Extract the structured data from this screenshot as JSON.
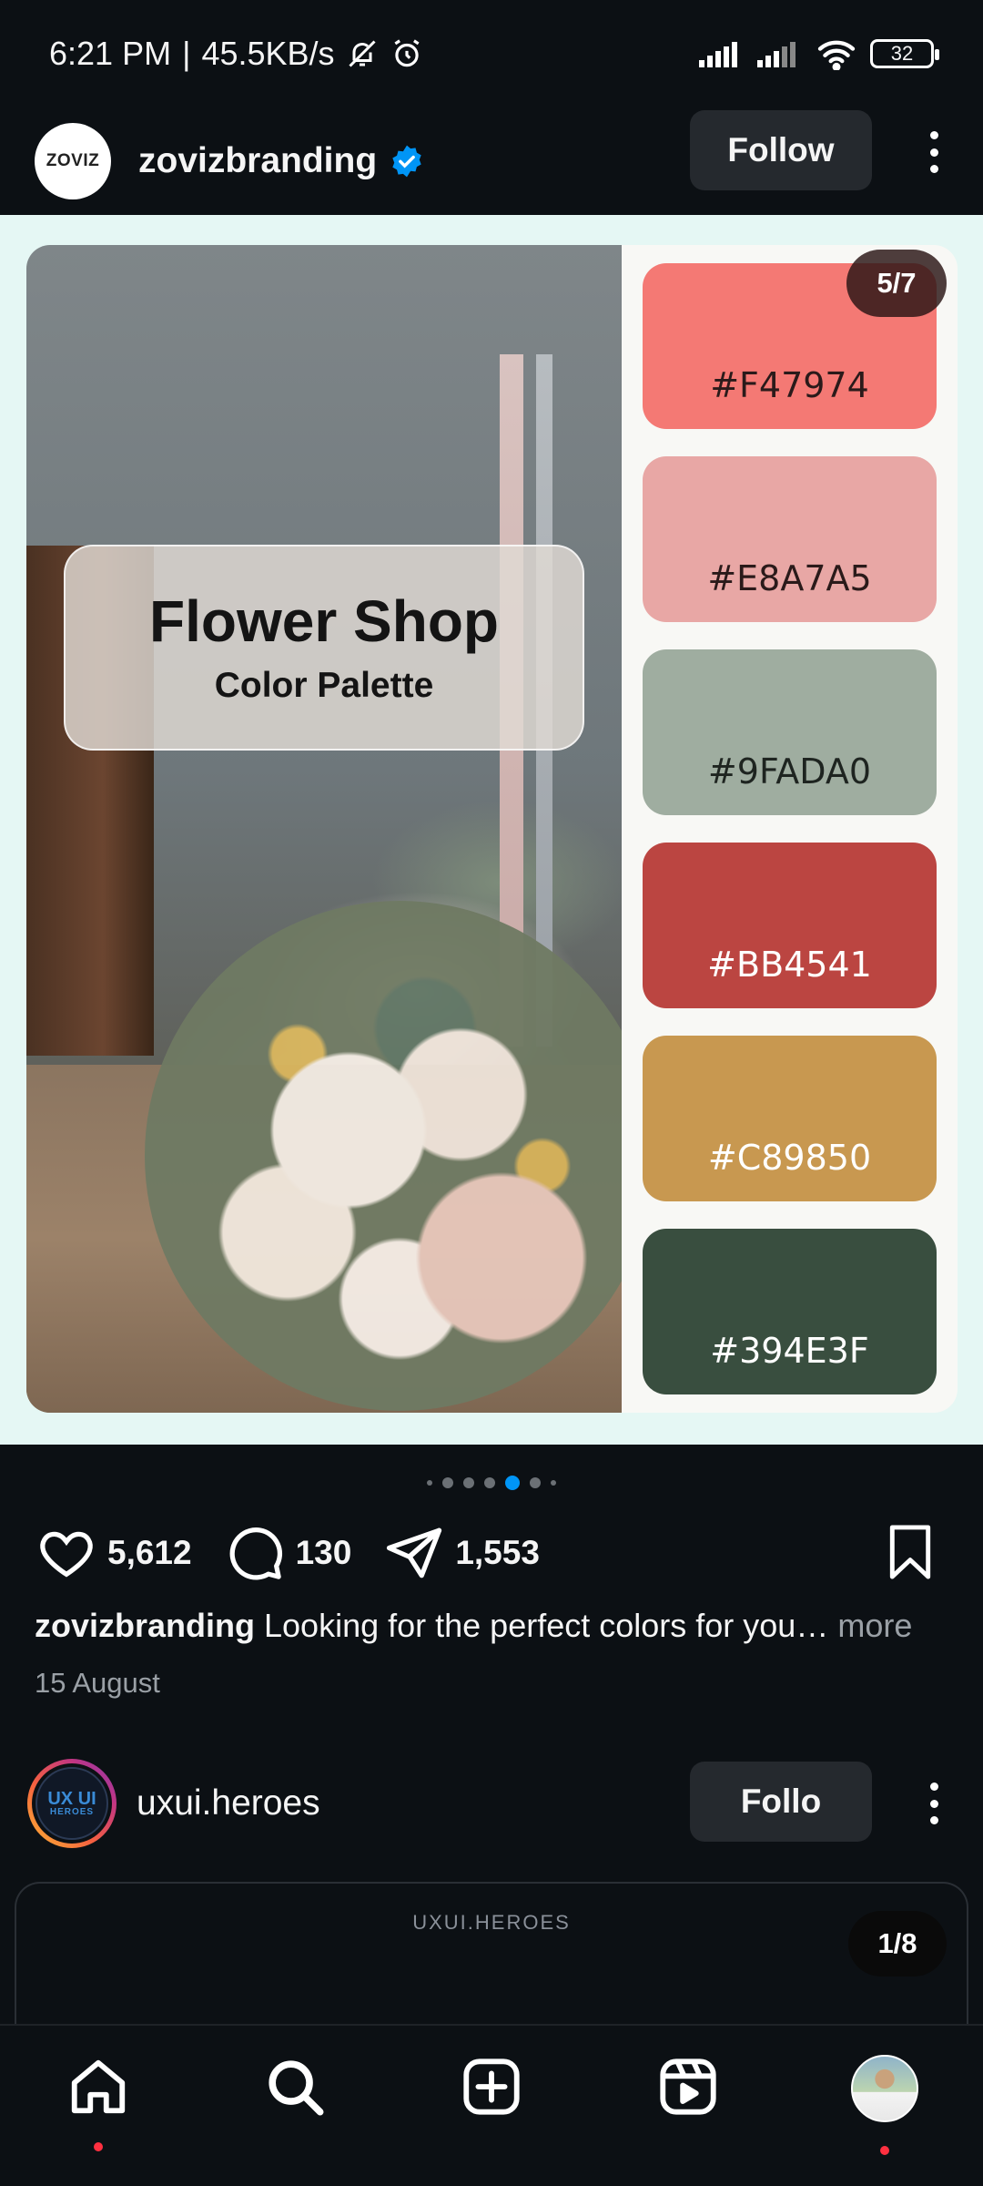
{
  "status_bar": {
    "time": "6:21 PM",
    "speed": "45.5KB/s",
    "battery": "32",
    "icons": [
      "mute-bell-icon",
      "alarm-icon",
      "signal-icon",
      "signal-icon",
      "wifi-icon",
      "battery-icon"
    ]
  },
  "post": {
    "username": "zovizbranding",
    "avatar_text": "ZOVIZ",
    "follow_label": "Follow",
    "media": {
      "title": "Flower Shop",
      "subtitle": "Color Palette",
      "counter": "5/7",
      "swatches": [
        {
          "hex": "#F47974",
          "color": "#F47974",
          "text_color": "#2a1a1a"
        },
        {
          "hex": "#E8A7A5",
          "color": "#E8A7A5",
          "text_color": "#2a1a1a"
        },
        {
          "hex": "#9FADA0",
          "color": "#9FADA0",
          "text_color": "#1e2420"
        },
        {
          "hex": "#BB4541",
          "color": "#BB4541",
          "text_color": "#ffffff"
        },
        {
          "hex": "#C89850",
          "color": "#C89850",
          "text_color": "#ffffff"
        },
        {
          "hex": "#394E3F",
          "color": "#394E3F",
          "text_color": "#ffffff"
        }
      ]
    },
    "carousel": {
      "total": 7,
      "active_index": 5
    },
    "likes": "5,612",
    "comments": "130",
    "shares": "1,553",
    "caption_user": "zovizbranding",
    "caption_text": "Looking for the perfect colors for you…",
    "caption_more": "more",
    "date": "15 August"
  },
  "next_post": {
    "username": "uxui.heroes",
    "follow_label": "Follo",
    "avatar_text": "UX UI",
    "avatar_sub": "HEROES",
    "brand_text": "UXUI.HEROES",
    "counter": "1/8"
  },
  "colors": {
    "background": "#0c1014",
    "accent": "#0095f6",
    "button_bg": "#25292e",
    "notification_dot": "#ff3040",
    "media_bg": "#e5f7f4"
  },
  "bottom_nav": [
    {
      "name": "home",
      "icon": "home-icon"
    },
    {
      "name": "search",
      "icon": "search-icon"
    },
    {
      "name": "create",
      "icon": "add-square-icon"
    },
    {
      "name": "reels",
      "icon": "reels-icon"
    },
    {
      "name": "profile",
      "icon": "profile-avatar"
    }
  ]
}
